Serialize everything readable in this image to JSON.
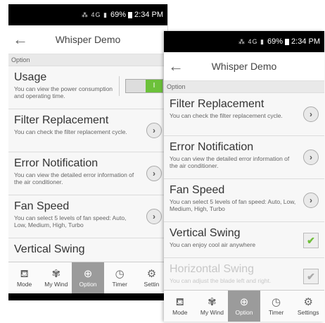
{
  "status": {
    "icons": "⁂ 4G ▮",
    "battery": "69%",
    "time": "2:34 PM"
  },
  "header": {
    "title": "Whisper Demo",
    "back": "←"
  },
  "section_label": "Option",
  "screen1": {
    "usage": {
      "title": "Usage",
      "desc": "You can view the power consumption and operating time.",
      "toggle": "I"
    },
    "items": [
      {
        "title": "Filter Replacement",
        "desc": "You can check the filter replacement cycle."
      },
      {
        "title": "Error Notification",
        "desc": "You can view the detailed error information of the air conditioner."
      },
      {
        "title": "Fan Speed",
        "desc": "You can select 5 levels of fan speed: Auto, Low, Medium, High, Turbo"
      },
      {
        "title": "Vertical Swing"
      }
    ]
  },
  "screen2": {
    "items": [
      {
        "title": "Filter Replacement",
        "desc": "You can check the filter replacement cycle."
      },
      {
        "title": "Error Notification",
        "desc": "You can view the detailed error information of the air conditioner."
      },
      {
        "title": "Fan Speed",
        "desc": "You can select 5 levels of fan speed: Auto, Low, Medium, High, Turbo"
      },
      {
        "title": "Vertical Swing",
        "desc": "You can enjoy cool air anywhere",
        "check": "✔"
      },
      {
        "title": "Horizontal Swing",
        "desc": "You can adjust the blade left and right.",
        "check": "✔"
      }
    ]
  },
  "tabs": [
    {
      "label": "Mode",
      "icon": "⛾"
    },
    {
      "label": "My Wind",
      "icon": "✾"
    },
    {
      "label": "Option",
      "icon": "⊕"
    },
    {
      "label": "Timer",
      "icon": "◷"
    },
    {
      "label": "Settings",
      "icon": "⚙"
    }
  ],
  "tabs_truncated_label": "Settin",
  "accent_color": "#6cc13a"
}
